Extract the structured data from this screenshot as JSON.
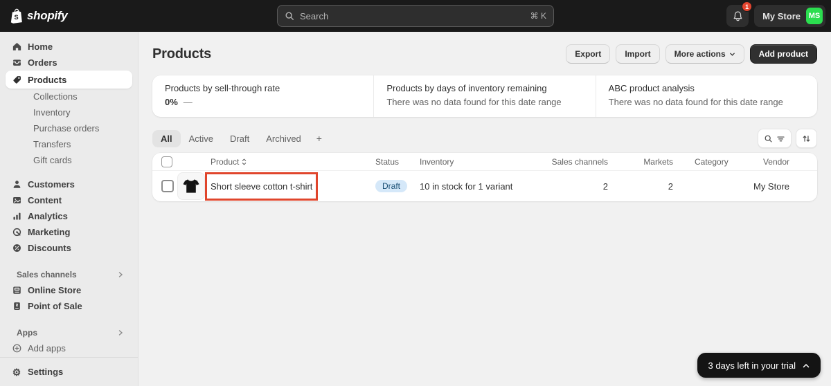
{
  "topbar": {
    "logo": "shopify",
    "logo_monogram": "S",
    "search_placeholder": "Search",
    "search_shortcut": "⌘ K",
    "notification_count": "1",
    "store_name": "My Store",
    "store_initials": "MS"
  },
  "sidebar": {
    "home": "Home",
    "orders": "Orders",
    "products": "Products",
    "products_sub": [
      "Collections",
      "Inventory",
      "Purchase orders",
      "Transfers",
      "Gift cards"
    ],
    "customers": "Customers",
    "content": "Content",
    "analytics": "Analytics",
    "marketing": "Marketing",
    "discounts": "Discounts",
    "sales_channels": "Sales channels",
    "online_store": "Online Store",
    "point_of_sale": "Point of Sale",
    "apps": "Apps",
    "add_apps": "Add apps",
    "settings": "Settings"
  },
  "icons": {
    "gear": "⚙"
  },
  "header": {
    "title": "Products",
    "export": "Export",
    "import": "Import",
    "more_actions": "More actions",
    "add_product": "Add product"
  },
  "insights": [
    {
      "label": "Products by sell-through rate",
      "value": "0%",
      "dash": "—"
    },
    {
      "label": "Products by days of inventory remaining",
      "empty": "There was no data found for this date range"
    },
    {
      "label": "ABC product analysis",
      "empty": "There was no data found for this date range"
    }
  ],
  "tabs": {
    "all": "All",
    "active": "Active",
    "draft": "Draft",
    "archived": "Archived",
    "add": "+"
  },
  "table": {
    "headers": {
      "product": "Product",
      "status": "Status",
      "inventory": "Inventory",
      "sales_channels": "Sales channels",
      "markets": "Markets",
      "category": "Category",
      "vendor": "Vendor"
    },
    "rows": [
      {
        "product": "Short sleeve cotton t-shirt",
        "status": "Draft",
        "inventory": "10 in stock for 1 variant",
        "sales_channels": "2",
        "markets": "2",
        "category": "",
        "vendor": "My Store"
      }
    ]
  },
  "trial": {
    "label": "3 days left in your trial"
  },
  "colors": {
    "topbar_bg": "#1A1A1A",
    "sidebar_bg": "#EBEBEB",
    "main_bg": "#F1F1F1",
    "accent_green": "#2BDE4F",
    "badge_info_bg": "#D5E8F9",
    "badge_info_text": "#1A4F75",
    "annotation_red": "#E0452C",
    "notification_red": "#E5452F"
  }
}
